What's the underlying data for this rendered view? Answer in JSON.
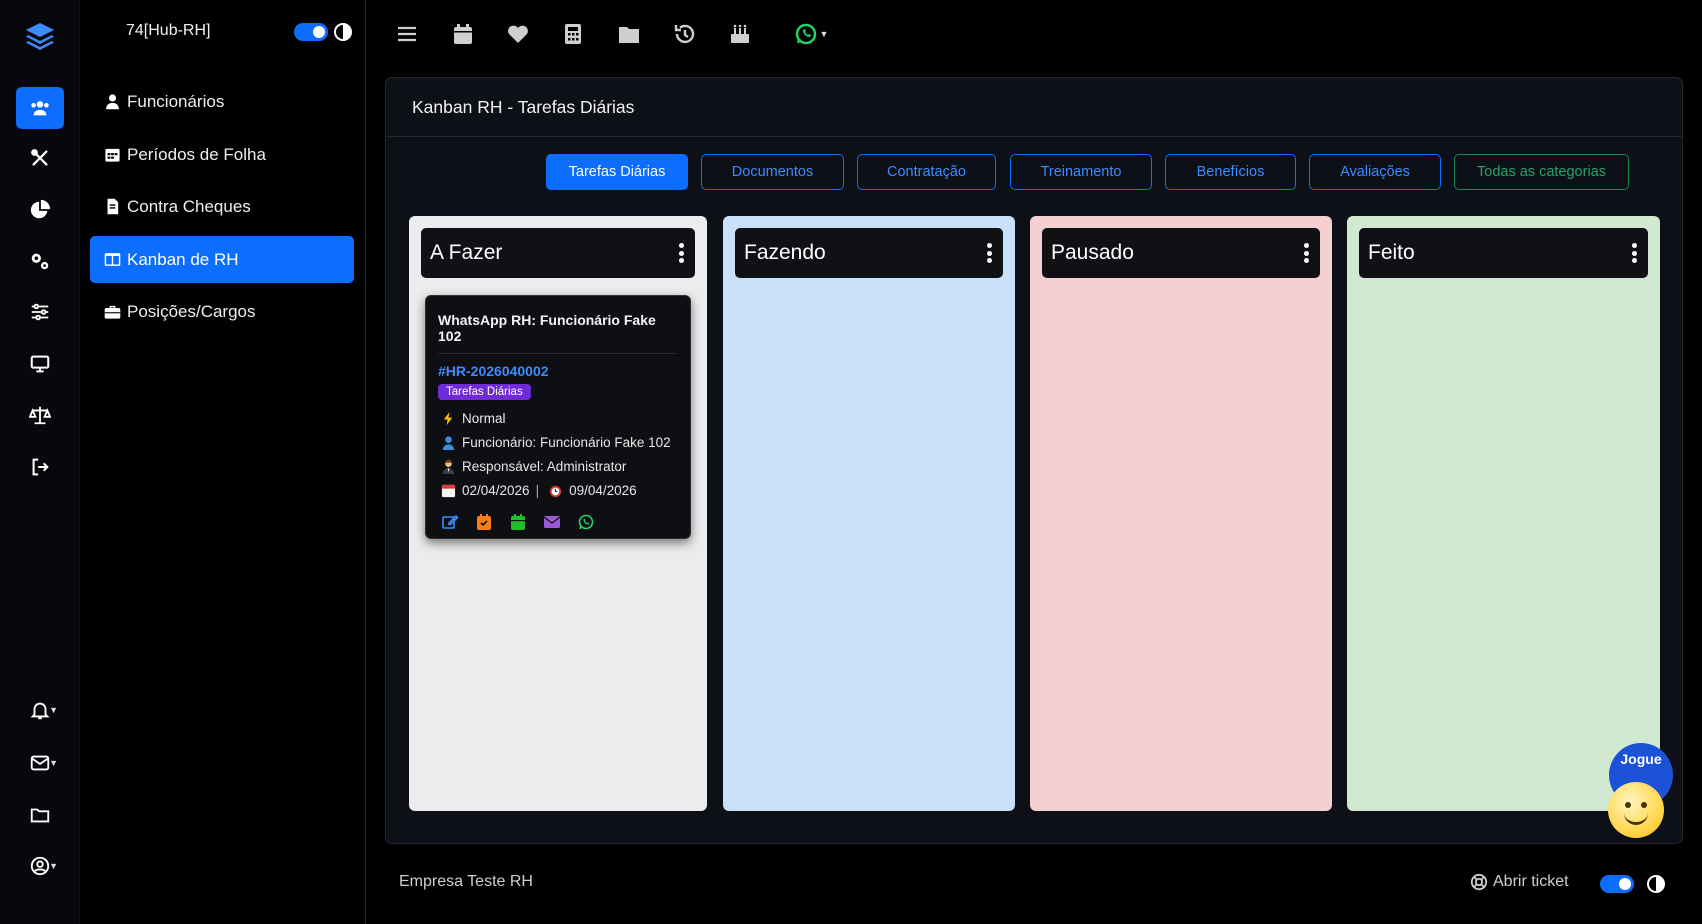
{
  "sidebar": {
    "brand": "74[Hub-RH]",
    "items": [
      {
        "label": "Funcionários",
        "icon": "user-tie-icon"
      },
      {
        "label": "Períodos de Folha",
        "icon": "calendar-icon"
      },
      {
        "label": "Contra Cheques",
        "icon": "file-invoice-icon"
      },
      {
        "label": "Kanban de RH",
        "icon": "columns-icon",
        "active": true
      },
      {
        "label": "Posições/Cargos",
        "icon": "briefcase-icon"
      }
    ]
  },
  "rail": {
    "icons": [
      "layers-logo-icon",
      "users-icon",
      "tools-icon",
      "pie-chart-icon",
      "gears-icon",
      "sliders-icon",
      "monitor-icon",
      "balance-scale-icon",
      "logout-icon",
      "bell-icon",
      "envelope-icon",
      "folder-icon",
      "user-circle-icon"
    ]
  },
  "topbar": {
    "icons": [
      "menu-icon",
      "calendar-icon",
      "heart-icon",
      "calculator-icon",
      "folder-icon",
      "history-icon",
      "birthday-cake-icon",
      "whatsapp-icon"
    ]
  },
  "panel": {
    "title": "Kanban RH - Tarefas Diárias"
  },
  "filters": [
    {
      "label": "Tarefas Diárias",
      "active": true
    },
    {
      "label": "Documentos"
    },
    {
      "label": "Contratação"
    },
    {
      "label": "Treinamento"
    },
    {
      "label": "Benefícios"
    },
    {
      "label": "Avaliações"
    },
    {
      "label": "Todas as categorias"
    }
  ],
  "columns": [
    {
      "title": "A Fazer",
      "bg": "#ececee"
    },
    {
      "title": "Fazendo",
      "bg": "#c9e0f9"
    },
    {
      "title": "Pausado",
      "bg": "#f6cfd2"
    },
    {
      "title": "Feito",
      "bg": "#d2e9d1"
    }
  ],
  "card": {
    "title": "WhatsApp RH: Funcionário Fake 102",
    "id": "#HR-2026040002",
    "badge": "Tarefas Diárias",
    "priority": "Normal",
    "employee": "Funcionário: Funcionário Fake 102",
    "responsible": "Responsável: Administrator",
    "start_date": "02/04/2026",
    "due_date": "09/04/2026",
    "separator": "|"
  },
  "footer": {
    "company": "Empresa Teste RH",
    "ticket": "Abrir ticket"
  },
  "game": {
    "label": "Jogue"
  },
  "colors": {
    "accent": "#0d6efd",
    "badge": "#6f2bd6",
    "green": "#198754"
  }
}
